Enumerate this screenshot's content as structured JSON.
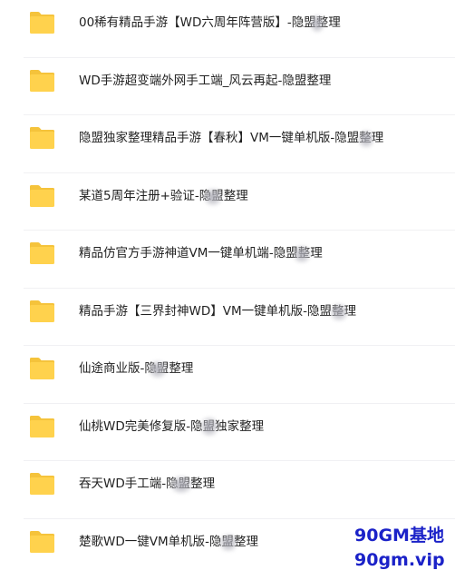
{
  "files": [
    {
      "name": "00稀有精品手游【WD六周年阵营版】-隐盟整理",
      "type": "folder"
    },
    {
      "name": "WD手游超变端外网手工端_风云再起-隐盟整理",
      "type": "folder"
    },
    {
      "name": "隐盟独家整理精品手游【春秋】VM一键单机版-隐盟整理",
      "type": "folder"
    },
    {
      "name": "某道5周年注册+验证-隐盟整理",
      "type": "folder"
    },
    {
      "name": "精品仿官方手游神道VM一键单机端-隐盟整理",
      "type": "folder"
    },
    {
      "name": "精品手游【三界封神WD】VM一键单机版-隐盟整理",
      "type": "folder"
    },
    {
      "name": "仙途商业版-隐盟整理",
      "type": "folder"
    },
    {
      "name": "仙桃WD完美修复版-隐盟独家整理",
      "type": "folder"
    },
    {
      "name": "吞天WD手工端-隐盟整理",
      "type": "folder"
    },
    {
      "name": "楚歌WD一键VM单机版-隐盟整理",
      "type": "folder"
    }
  ],
  "watermark": {
    "line1": "90GM基地",
    "line2": "90gm.vip"
  },
  "colors": {
    "folder_back": "#f5c33b",
    "folder_front": "#ffd24d",
    "text": "#222222",
    "watermark": "#1b22c8"
  }
}
